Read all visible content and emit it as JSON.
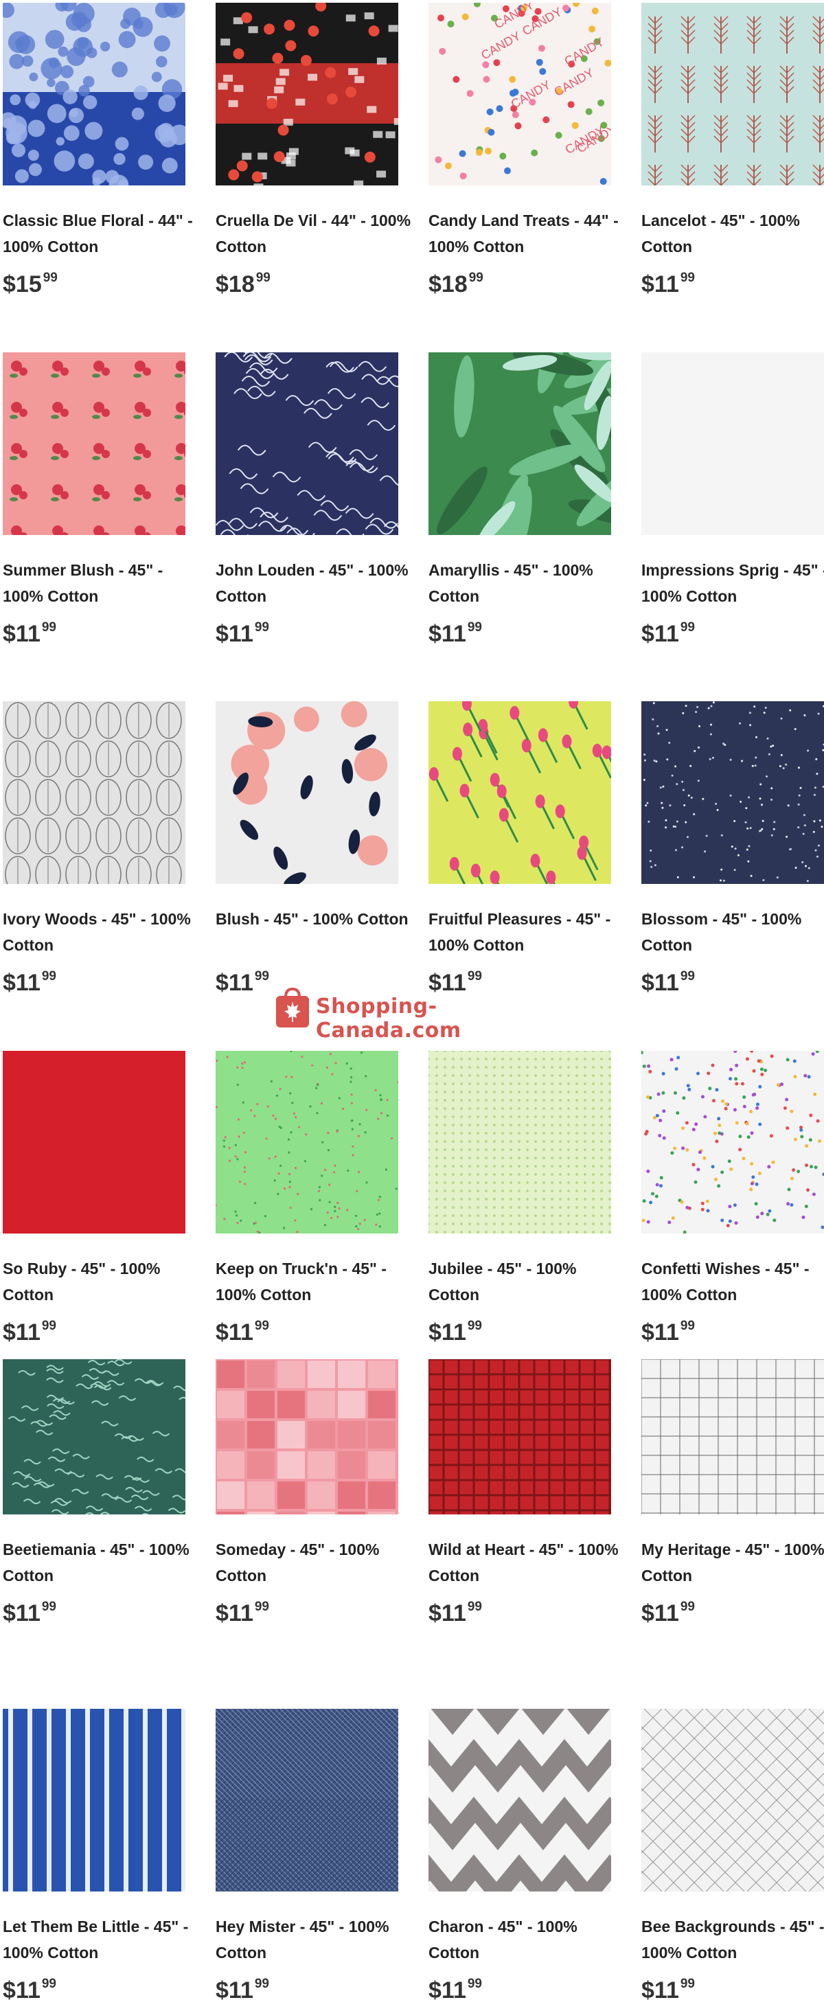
{
  "products": [
    {
      "name": "Classic Blue Floral - 44\" - 100% Cotton",
      "dollars": "$15",
      "cents": "99",
      "pattern": "blue-floral"
    },
    {
      "name": "Cruella De Vil - 44\" - 100% Cotton",
      "dollars": "$18",
      "cents": "99",
      "pattern": "cruella"
    },
    {
      "name": "Candy Land Treats - 44\" - 100% Cotton",
      "dollars": "$18",
      "cents": "99",
      "pattern": "candy"
    },
    {
      "name": "Lancelot - 45\" - 100% Cotton",
      "dollars": "$11",
      "cents": "99",
      "pattern": "trees"
    },
    {
      "name": "Summer Blush - 45\" - 100% Cotton",
      "dollars": "$11",
      "cents": "99",
      "pattern": "pink-roses"
    },
    {
      "name": "John Louden - 45\" - 100% Cotton",
      "dollars": "$11",
      "cents": "99",
      "pattern": "navy-vines"
    },
    {
      "name": "Amaryllis - 45\" - 100% Cotton",
      "dollars": "$11",
      "cents": "99",
      "pattern": "amaryllis"
    },
    {
      "name": "Impressions Sprig - 45\" - 100% Cotton",
      "dollars": "$11",
      "cents": "99",
      "pattern": "white-sprig"
    },
    {
      "name": "Ivory Woods - 45\" - 100% Cotton",
      "dollars": "$11",
      "cents": "99",
      "pattern": "grey-leaves"
    },
    {
      "name": "Blush - 45\" - 100% Cotton",
      "dollars": "$11",
      "cents": "99",
      "pattern": "blush-flowers"
    },
    {
      "name": "Fruitful Pleasures - 45\" - 100% Cotton",
      "dollars": "$11",
      "cents": "99",
      "pattern": "tulips"
    },
    {
      "name": "Blossom - 45\" - 100% Cotton",
      "dollars": "$11",
      "cents": "99",
      "pattern": "navy-dots"
    },
    {
      "name": "So Ruby - 45\" - 100% Cotton",
      "dollars": "$11",
      "cents": "99",
      "pattern": "red-solid"
    },
    {
      "name": "Keep on Truck'n - 45\" - 100% Cotton",
      "dollars": "$11",
      "cents": "99",
      "pattern": "green-dots"
    },
    {
      "name": "Jubilee - 45\" - 100% Cotton",
      "dollars": "$11",
      "cents": "99",
      "pattern": "pale-green"
    },
    {
      "name": "Confetti Wishes - 45\" - 100% Cotton",
      "dollars": "$11",
      "cents": "99",
      "pattern": "confetti"
    },
    {
      "name": "Beetiemania - 45\" - 100% Cotton",
      "dollars": "$11",
      "cents": "99",
      "pattern": "green-squiggle"
    },
    {
      "name": "Someday - 45\" - 100% Cotton",
      "dollars": "$11",
      "cents": "99",
      "pattern": "pink-patch"
    },
    {
      "name": "Wild at Heart - 45\" - 100% Cotton",
      "dollars": "$11",
      "cents": "99",
      "pattern": "red-plaid"
    },
    {
      "name": "My Heritage - 45\" - 100% Cotton",
      "dollars": "$11",
      "cents": "99",
      "pattern": "grid"
    },
    {
      "name": "Let Them Be Little - 45\" - 100% Cotton",
      "dollars": "$11",
      "cents": "99",
      "pattern": "blue-stripes"
    },
    {
      "name": "Hey Mister - 45\" - 100% Cotton",
      "dollars": "$11",
      "cents": "99",
      "pattern": "blue-crosshatch"
    },
    {
      "name": "Charon - 45\" - 100% Cotton",
      "dollars": "$11",
      "cents": "99",
      "pattern": "chevron"
    },
    {
      "name": "Bee Backgrounds - 45\" - 100% Cotton",
      "dollars": "$11",
      "cents": "99",
      "pattern": "diag-grid"
    }
  ],
  "watermark": {
    "text": "Shopping-Canada.com",
    "icon": "shopping-bag-maple-leaf-icon",
    "color": "#d9534f"
  }
}
